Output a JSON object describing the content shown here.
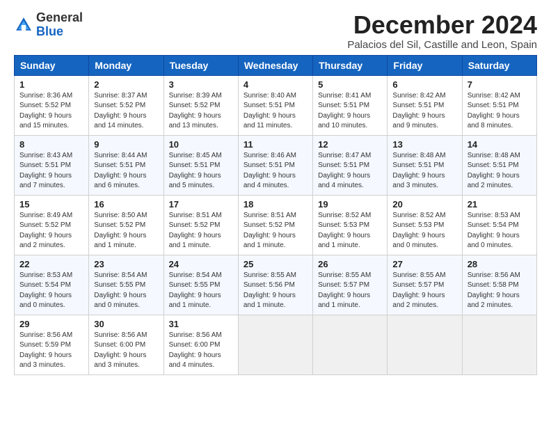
{
  "logo": {
    "general": "General",
    "blue": "Blue"
  },
  "header": {
    "month_title": "December 2024",
    "location": "Palacios del Sil, Castille and Leon, Spain"
  },
  "weekdays": [
    "Sunday",
    "Monday",
    "Tuesday",
    "Wednesday",
    "Thursday",
    "Friday",
    "Saturday"
  ],
  "weeks": [
    [
      {
        "day": "1",
        "sunrise": "8:36 AM",
        "sunset": "5:52 PM",
        "daylight": "9 hours and 15 minutes."
      },
      {
        "day": "2",
        "sunrise": "8:37 AM",
        "sunset": "5:52 PM",
        "daylight": "9 hours and 14 minutes."
      },
      {
        "day": "3",
        "sunrise": "8:39 AM",
        "sunset": "5:52 PM",
        "daylight": "9 hours and 13 minutes."
      },
      {
        "day": "4",
        "sunrise": "8:40 AM",
        "sunset": "5:51 PM",
        "daylight": "9 hours and 11 minutes."
      },
      {
        "day": "5",
        "sunrise": "8:41 AM",
        "sunset": "5:51 PM",
        "daylight": "9 hours and 10 minutes."
      },
      {
        "day": "6",
        "sunrise": "8:42 AM",
        "sunset": "5:51 PM",
        "daylight": "9 hours and 9 minutes."
      },
      {
        "day": "7",
        "sunrise": "8:42 AM",
        "sunset": "5:51 PM",
        "daylight": "9 hours and 8 minutes."
      }
    ],
    [
      {
        "day": "8",
        "sunrise": "8:43 AM",
        "sunset": "5:51 PM",
        "daylight": "9 hours and 7 minutes."
      },
      {
        "day": "9",
        "sunrise": "8:44 AM",
        "sunset": "5:51 PM",
        "daylight": "9 hours and 6 minutes."
      },
      {
        "day": "10",
        "sunrise": "8:45 AM",
        "sunset": "5:51 PM",
        "daylight": "9 hours and 5 minutes."
      },
      {
        "day": "11",
        "sunrise": "8:46 AM",
        "sunset": "5:51 PM",
        "daylight": "9 hours and 4 minutes."
      },
      {
        "day": "12",
        "sunrise": "8:47 AM",
        "sunset": "5:51 PM",
        "daylight": "9 hours and 4 minutes."
      },
      {
        "day": "13",
        "sunrise": "8:48 AM",
        "sunset": "5:51 PM",
        "daylight": "9 hours and 3 minutes."
      },
      {
        "day": "14",
        "sunrise": "8:48 AM",
        "sunset": "5:51 PM",
        "daylight": "9 hours and 2 minutes."
      }
    ],
    [
      {
        "day": "15",
        "sunrise": "8:49 AM",
        "sunset": "5:52 PM",
        "daylight": "9 hours and 2 minutes."
      },
      {
        "day": "16",
        "sunrise": "8:50 AM",
        "sunset": "5:52 PM",
        "daylight": "9 hours and 1 minute."
      },
      {
        "day": "17",
        "sunrise": "8:51 AM",
        "sunset": "5:52 PM",
        "daylight": "9 hours and 1 minute."
      },
      {
        "day": "18",
        "sunrise": "8:51 AM",
        "sunset": "5:52 PM",
        "daylight": "9 hours and 1 minute."
      },
      {
        "day": "19",
        "sunrise": "8:52 AM",
        "sunset": "5:53 PM",
        "daylight": "9 hours and 1 minute."
      },
      {
        "day": "20",
        "sunrise": "8:52 AM",
        "sunset": "5:53 PM",
        "daylight": "9 hours and 0 minutes."
      },
      {
        "day": "21",
        "sunrise": "8:53 AM",
        "sunset": "5:54 PM",
        "daylight": "9 hours and 0 minutes."
      }
    ],
    [
      {
        "day": "22",
        "sunrise": "8:53 AM",
        "sunset": "5:54 PM",
        "daylight": "9 hours and 0 minutes."
      },
      {
        "day": "23",
        "sunrise": "8:54 AM",
        "sunset": "5:55 PM",
        "daylight": "9 hours and 0 minutes."
      },
      {
        "day": "24",
        "sunrise": "8:54 AM",
        "sunset": "5:55 PM",
        "daylight": "9 hours and 1 minute."
      },
      {
        "day": "25",
        "sunrise": "8:55 AM",
        "sunset": "5:56 PM",
        "daylight": "9 hours and 1 minute."
      },
      {
        "day": "26",
        "sunrise": "8:55 AM",
        "sunset": "5:57 PM",
        "daylight": "9 hours and 1 minute."
      },
      {
        "day": "27",
        "sunrise": "8:55 AM",
        "sunset": "5:57 PM",
        "daylight": "9 hours and 2 minutes."
      },
      {
        "day": "28",
        "sunrise": "8:56 AM",
        "sunset": "5:58 PM",
        "daylight": "9 hours and 2 minutes."
      }
    ],
    [
      {
        "day": "29",
        "sunrise": "8:56 AM",
        "sunset": "5:59 PM",
        "daylight": "9 hours and 3 minutes."
      },
      {
        "day": "30",
        "sunrise": "8:56 AM",
        "sunset": "6:00 PM",
        "daylight": "9 hours and 3 minutes."
      },
      {
        "day": "31",
        "sunrise": "8:56 AM",
        "sunset": "6:00 PM",
        "daylight": "9 hours and 4 minutes."
      },
      null,
      null,
      null,
      null
    ]
  ]
}
